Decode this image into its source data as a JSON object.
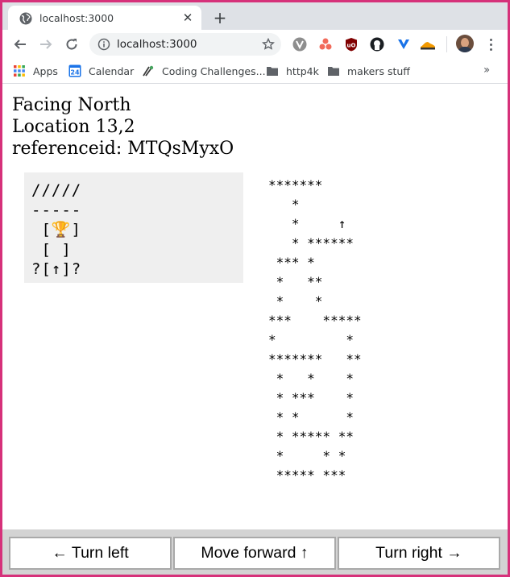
{
  "browser": {
    "tab_title": "localhost:3000",
    "url": "localhost:3000",
    "bookmarks": [
      {
        "label": "Apps",
        "icon": "apps-grid-icon"
      },
      {
        "label": "Calendar",
        "icon": "calendar-icon",
        "badge": "24"
      },
      {
        "label": "Coding Challenges...",
        "icon": "coding-challenges-icon"
      },
      {
        "label": "http4k",
        "icon": "folder-icon"
      },
      {
        "label": "makers stuff",
        "icon": "folder-icon"
      }
    ]
  },
  "status": {
    "facing": "Facing North",
    "location": "Location 13,2",
    "reference": "referenceid: MTQsMyxO"
  },
  "view": {
    "lines": [
      "/////",
      "-----",
      " [🏆]",
      " [ ]",
      "?[↑]?"
    ]
  },
  "maze": {
    "rows": [
      "*******",
      "   *",
      "   *     ↑",
      "   * ******",
      " *** *",
      " *   **",
      " *    *",
      "***    *****",
      "*         *",
      "*******   **",
      " *   *    *",
      " * ***    *",
      " * *      *",
      " * ***** **",
      " *     * *",
      " ***** ***"
    ]
  },
  "controls": {
    "turn_left": "← Turn left",
    "move_forward": "Move forward ↑",
    "turn_right": "Turn right →"
  },
  "colors": {
    "window_border": "#d6317a",
    "tab_strip": "#dee1e6",
    "view_bg": "#efefef",
    "controls_bg": "#d3d3d3"
  }
}
